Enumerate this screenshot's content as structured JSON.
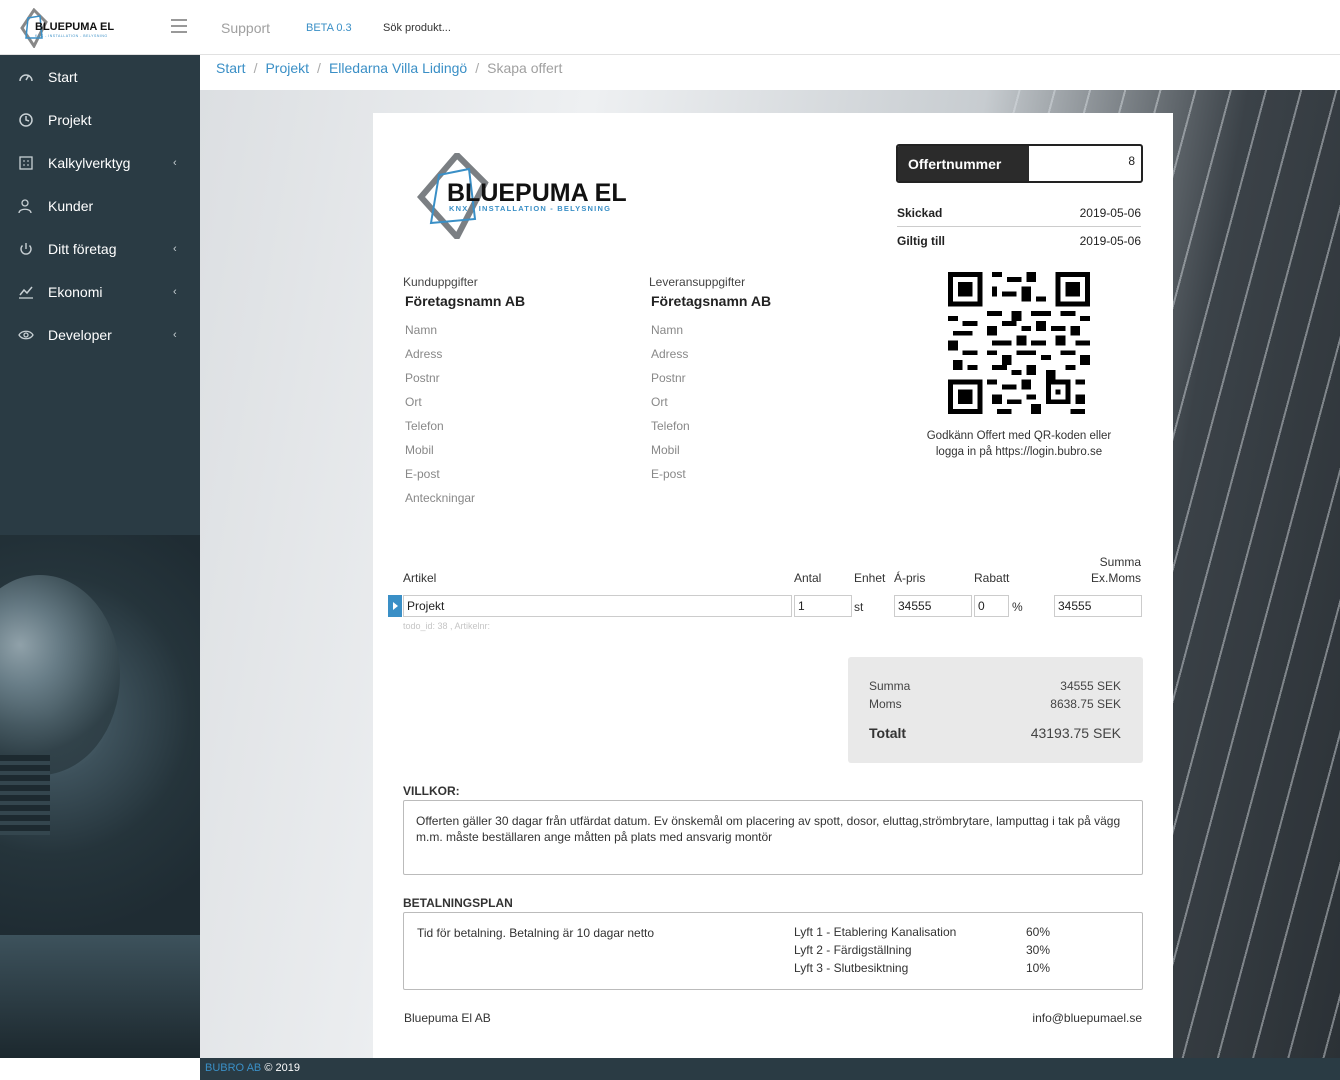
{
  "app": {
    "logo_text": "BLUEPUMA EL",
    "logo_tagline": "KNX - INSTALLATION - BELYSNING",
    "support_label": "Support",
    "beta_label": "BETA 0.3",
    "search_placeholder": "Sök produkt..."
  },
  "sidebar": {
    "items": [
      {
        "label": "Start",
        "icon": "dashboard-icon",
        "caret": ""
      },
      {
        "label": "Projekt",
        "icon": "clock-icon",
        "caret": ""
      },
      {
        "label": "Kalkylverktyg",
        "icon": "calculator-icon",
        "caret": "‹"
      },
      {
        "label": "Kunder",
        "icon": "users-icon",
        "caret": ""
      },
      {
        "label": "Ditt företag",
        "icon": "power-icon",
        "caret": "‹"
      },
      {
        "label": "Ekonomi",
        "icon": "chart-line-icon",
        "caret": "‹"
      },
      {
        "label": "Developer",
        "icon": "eye-icon",
        "caret": "‹"
      }
    ]
  },
  "breadcrumb": {
    "items": [
      "Start",
      "Projekt",
      "Elledarna Villa Lidingö"
    ],
    "current": "Skapa offert"
  },
  "offer": {
    "number_label": "Offertnummer",
    "number_value": "8",
    "sent_label": "Skickad",
    "sent_date": "2019-05-06",
    "valid_label": "Giltig till",
    "valid_date": "2019-05-06",
    "qr_text_line1": "Godkänn Offert med QR-koden eller",
    "qr_text_line2": "logga in på https://login.bubro.se"
  },
  "customer": {
    "heading": "Kunduppgifter",
    "company": "Företagsnamn AB",
    "fields": [
      "Namn",
      "Adress",
      "Postnr",
      "Ort",
      "Telefon",
      "Mobil",
      "E-post",
      "Anteckningar"
    ]
  },
  "delivery": {
    "heading": "Leveransuppgifter",
    "company": "Företagsnamn AB",
    "fields": [
      "Namn",
      "Adress",
      "Postnr",
      "Ort",
      "Telefon",
      "Mobil",
      "E-post"
    ]
  },
  "articles": {
    "headers": {
      "article": "Artikel",
      "qty": "Antal",
      "unit": "Enhet",
      "price": "Á-pris",
      "discount": "Rabatt",
      "sum_line1": "Summa",
      "sum_line2": "Ex.Moms"
    },
    "row": {
      "article": "Projekt",
      "qty": "1",
      "unit": "st",
      "price": "34555",
      "discount": "0",
      "discount_unit": "%",
      "sum": "34555",
      "meta": "todo_id: 38 , Artikelnr:"
    }
  },
  "totals": {
    "sum_label": "Summa",
    "sum_value": "34555 SEK",
    "vat_label": "Moms",
    "vat_value": "8638.75 SEK",
    "total_label": "Totalt",
    "total_value": "43193.75 SEK"
  },
  "terms": {
    "title": "VILLKOR:",
    "text": "Offerten gäller 30 dagar från utfärdat datum. Ev önskemål om placering av spott, dosor, eluttag,strömbrytare, lamputtag i tak på vägg m.m. måste beställaren ange måtten på plats med ansvarig montör"
  },
  "payment": {
    "title": "BETALNINGSPLAN",
    "text": "Tid för betalning. Betalning är  10 dagar  netto",
    "items": [
      {
        "name": "Lyft 1 - Etablering Kanalisation",
        "pct": "60%"
      },
      {
        "name": "Lyft 2 - Färdigställning",
        "pct": "30%"
      },
      {
        "name": "Lyft 3 - Slutbesiktning",
        "pct": "10%"
      }
    ]
  },
  "doc_footer": {
    "company": "Bluepuma El AB",
    "email": "info@bluepumael.se"
  },
  "footer": {
    "company": "BUBRO AB",
    "copyright": "© 2019"
  },
  "colors": {
    "sidebar": "#2a3b44",
    "accent": "#3a8fc6",
    "offer_label_bg": "#2b2b2b",
    "totals_bg": "#e9e9e9"
  }
}
